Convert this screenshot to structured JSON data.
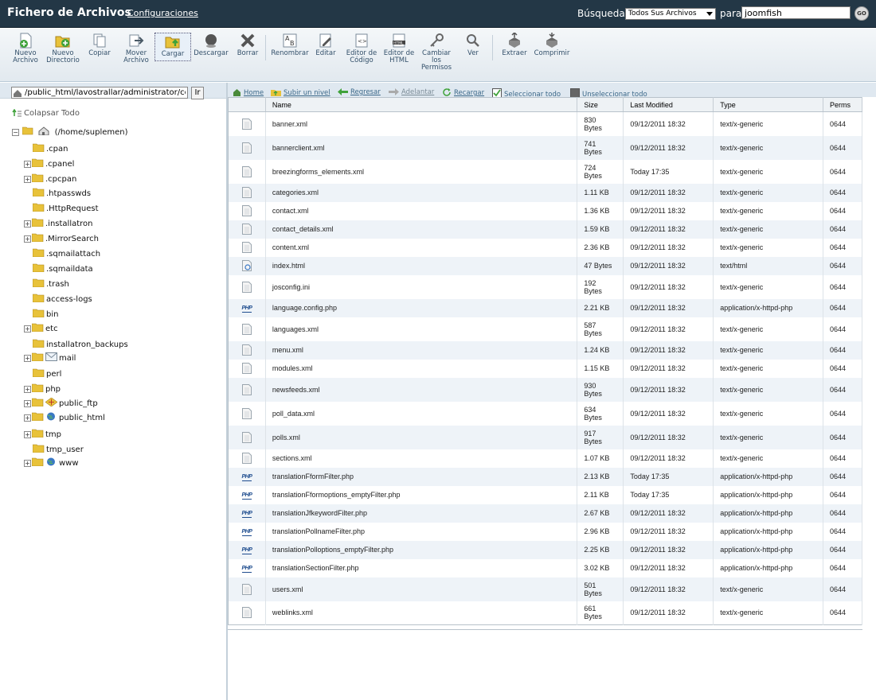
{
  "header": {
    "title": "Fichero de Archivos",
    "config_link": "Configuraciones",
    "search_label": "Búsqueda",
    "search_scope": "Todos Sus Archivos",
    "para_label": "para",
    "search_value": "joomfish",
    "go_label": "GO"
  },
  "toolbar": {
    "new_file": "Nuevo Archivo",
    "new_dir": "Nuevo Directorio",
    "copy": "Copiar",
    "move": "Mover Archivo",
    "upload": "Cargar",
    "download": "Descargar",
    "delete": "Borrar",
    "rename": "Renombrar",
    "edit": "Editar",
    "code_editor": "Editor de Código",
    "html_editor": "Editor de HTML",
    "permissions": "Cambiar los Permisos",
    "view": "Ver",
    "extract": "Extraer",
    "compress": "Comprimir"
  },
  "path": {
    "value": "/public_html/lavostrallar/administrator/co",
    "go_label": "Ir"
  },
  "nav": {
    "home": "Home",
    "up": "Subir un nivel",
    "back": "Regresar",
    "forward": "Adelantar",
    "reload": "Recargar",
    "select_all": "Seleccionar todo",
    "unselect_all": "Unseleccionar todo"
  },
  "tree": {
    "collapse_all": "Colapsar Todo",
    "root": "(/home/suplemen)",
    "items": [
      {
        "label": ".cpan",
        "expandable": false
      },
      {
        "label": ".cpanel",
        "expandable": true
      },
      {
        "label": ".cpcpan",
        "expandable": true
      },
      {
        "label": ".htpasswds",
        "expandable": false
      },
      {
        "label": ".HttpRequest",
        "expandable": false
      },
      {
        "label": ".installatron",
        "expandable": true
      },
      {
        "label": ".MirrorSearch",
        "expandable": true
      },
      {
        "label": ".sqmailattach",
        "expandable": false
      },
      {
        "label": ".sqmaildata",
        "expandable": false
      },
      {
        "label": ".trash",
        "expandable": false
      },
      {
        "label": "access-logs",
        "expandable": false
      },
      {
        "label": "bin",
        "expandable": false
      },
      {
        "label": "etc",
        "expandable": true
      },
      {
        "label": "installatron_backups",
        "expandable": false
      },
      {
        "label": "mail",
        "expandable": true
      },
      {
        "label": "perl",
        "expandable": false
      },
      {
        "label": "php",
        "expandable": true
      },
      {
        "label": "public_ftp",
        "expandable": true
      },
      {
        "label": "public_html",
        "expandable": true
      },
      {
        "label": "tmp",
        "expandable": true
      },
      {
        "label": "tmp_user",
        "expandable": false
      },
      {
        "label": "www",
        "expandable": true
      }
    ]
  },
  "table": {
    "columns": {
      "name": "Name",
      "size": "Size",
      "modified": "Last Modified",
      "type": "Type",
      "perms": "Perms"
    },
    "rows": [
      {
        "icon": "file",
        "name": "banner.xml",
        "size": "830 Bytes",
        "modified": "09/12/2011 18:32",
        "type": "text/x-generic",
        "perms": "0644"
      },
      {
        "icon": "file",
        "name": "bannerclient.xml",
        "size": "741 Bytes",
        "modified": "09/12/2011 18:32",
        "type": "text/x-generic",
        "perms": "0644"
      },
      {
        "icon": "file",
        "name": "breezingforms_elements.xml",
        "size": "724 Bytes",
        "modified": "Today 17:35",
        "type": "text/x-generic",
        "perms": "0644"
      },
      {
        "icon": "file",
        "name": "categories.xml",
        "size": "1.11 KB",
        "modified": "09/12/2011 18:32",
        "type": "text/x-generic",
        "perms": "0644"
      },
      {
        "icon": "file",
        "name": "contact.xml",
        "size": "1.36 KB",
        "modified": "09/12/2011 18:32",
        "type": "text/x-generic",
        "perms": "0644"
      },
      {
        "icon": "file",
        "name": "contact_details.xml",
        "size": "1.59 KB",
        "modified": "09/12/2011 18:32",
        "type": "text/x-generic",
        "perms": "0644"
      },
      {
        "icon": "file",
        "name": "content.xml",
        "size": "2.36 KB",
        "modified": "09/12/2011 18:32",
        "type": "text/x-generic",
        "perms": "0644"
      },
      {
        "icon": "html",
        "name": "index.html",
        "size": "47 Bytes",
        "modified": "09/12/2011 18:32",
        "type": "text/html",
        "perms": "0644"
      },
      {
        "icon": "file",
        "name": "josconfig.ini",
        "size": "192 Bytes",
        "modified": "09/12/2011 18:32",
        "type": "text/x-generic",
        "perms": "0644"
      },
      {
        "icon": "php",
        "name": "language.config.php",
        "size": "2.21 KB",
        "modified": "09/12/2011 18:32",
        "type": "application/x-httpd-php",
        "perms": "0644"
      },
      {
        "icon": "file",
        "name": "languages.xml",
        "size": "587 Bytes",
        "modified": "09/12/2011 18:32",
        "type": "text/x-generic",
        "perms": "0644"
      },
      {
        "icon": "file",
        "name": "menu.xml",
        "size": "1.24 KB",
        "modified": "09/12/2011 18:32",
        "type": "text/x-generic",
        "perms": "0644"
      },
      {
        "icon": "file",
        "name": "modules.xml",
        "size": "1.15 KB",
        "modified": "09/12/2011 18:32",
        "type": "text/x-generic",
        "perms": "0644"
      },
      {
        "icon": "file",
        "name": "newsfeeds.xml",
        "size": "930 Bytes",
        "modified": "09/12/2011 18:32",
        "type": "text/x-generic",
        "perms": "0644"
      },
      {
        "icon": "file",
        "name": "poll_data.xml",
        "size": "634 Bytes",
        "modified": "09/12/2011 18:32",
        "type": "text/x-generic",
        "perms": "0644"
      },
      {
        "icon": "file",
        "name": "polls.xml",
        "size": "917 Bytes",
        "modified": "09/12/2011 18:32",
        "type": "text/x-generic",
        "perms": "0644"
      },
      {
        "icon": "file",
        "name": "sections.xml",
        "size": "1.07 KB",
        "modified": "09/12/2011 18:32",
        "type": "text/x-generic",
        "perms": "0644"
      },
      {
        "icon": "php",
        "name": "translationFformFilter.php",
        "size": "2.13 KB",
        "modified": "Today 17:35",
        "type": "application/x-httpd-php",
        "perms": "0644"
      },
      {
        "icon": "php",
        "name": "translationFformoptions_emptyFilter.php",
        "size": "2.11 KB",
        "modified": "Today 17:35",
        "type": "application/x-httpd-php",
        "perms": "0644"
      },
      {
        "icon": "php",
        "name": "translationJfkeywordFilter.php",
        "size": "2.67 KB",
        "modified": "09/12/2011 18:32",
        "type": "application/x-httpd-php",
        "perms": "0644"
      },
      {
        "icon": "php",
        "name": "translationPollnameFilter.php",
        "size": "2.96 KB",
        "modified": "09/12/2011 18:32",
        "type": "application/x-httpd-php",
        "perms": "0644"
      },
      {
        "icon": "php",
        "name": "translationPolloptions_emptyFilter.php",
        "size": "2.25 KB",
        "modified": "09/12/2011 18:32",
        "type": "application/x-httpd-php",
        "perms": "0644"
      },
      {
        "icon": "php",
        "name": "translationSectionFilter.php",
        "size": "3.02 KB",
        "modified": "09/12/2011 18:32",
        "type": "application/x-httpd-php",
        "perms": "0644"
      },
      {
        "icon": "file",
        "name": "users.xml",
        "size": "501 Bytes",
        "modified": "09/12/2011 18:32",
        "type": "text/x-generic",
        "perms": "0644"
      },
      {
        "icon": "file",
        "name": "weblinks.xml",
        "size": "661 Bytes",
        "modified": "09/12/2011 18:32",
        "type": "text/x-generic",
        "perms": "0644"
      }
    ]
  }
}
